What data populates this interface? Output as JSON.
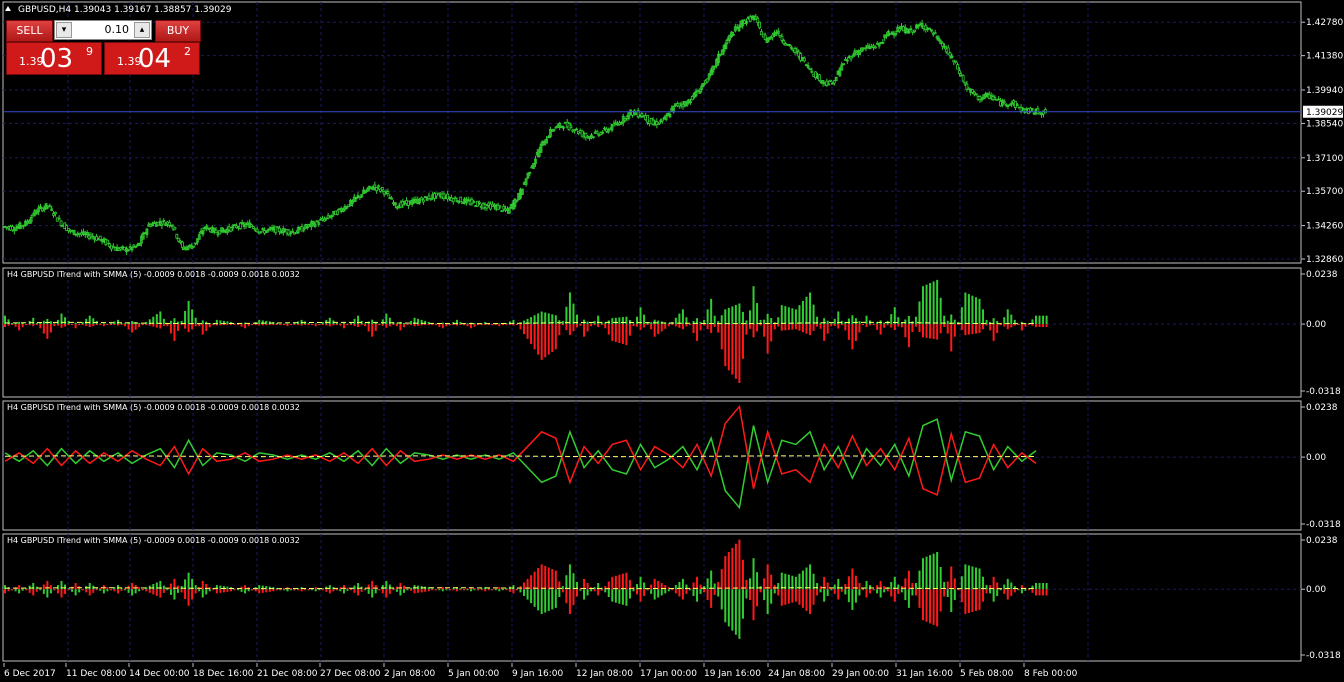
{
  "window": {
    "symbol_header": "GBPUSD,H4  1.39043 1.39167 1.38857 1.39029"
  },
  "trade_panel": {
    "sell_label": "SELL",
    "buy_label": "BUY",
    "lot_value": "0.10",
    "sell_price": {
      "small": "1.39",
      "big": "03",
      "sup": "9"
    },
    "buy_price": {
      "small": "1.39",
      "big": "04",
      "sup": "2"
    }
  },
  "colors": {
    "background": "#000000",
    "grid": "#1a1a66",
    "axis": "#c0c0c0",
    "bull": "#32cd32",
    "bear": "#ff1a1a",
    "signal": "#ffff66",
    "text": "#ffffff",
    "sell_button": "#d01a1a"
  },
  "chart_data": [
    {
      "type": "candlestick",
      "title": "GBPUSD,H4  1.39043 1.39167 1.38857 1.39029",
      "ylim": [
        1.3286,
        1.4346
      ],
      "y_ticks": [
        "1.42780",
        "1.41380",
        "1.39940",
        "1.38540",
        "1.37100",
        "1.35700",
        "1.34260",
        "1.32860"
      ],
      "current_price": "1.39029",
      "close_series": [
        1.3422,
        1.3415,
        1.3435,
        1.349,
        1.351,
        1.3445,
        1.34,
        1.339,
        1.338,
        1.336,
        1.333,
        1.3325,
        1.334,
        1.343,
        1.344,
        1.3435,
        1.333,
        1.3345,
        1.342,
        1.34,
        1.341,
        1.3425,
        1.343,
        1.34,
        1.341,
        1.3405,
        1.34,
        1.342,
        1.344,
        1.346,
        1.349,
        1.352,
        1.356,
        1.359,
        1.357,
        1.351,
        1.352,
        1.353,
        1.3545,
        1.3555,
        1.354,
        1.353,
        1.352,
        1.351,
        1.3505,
        1.3485,
        1.355,
        1.366,
        1.376,
        1.383,
        1.385,
        1.383,
        1.38,
        1.381,
        1.383,
        1.386,
        1.39,
        1.389,
        1.385,
        1.387,
        1.393,
        1.394,
        1.399,
        1.405,
        1.415,
        1.423,
        1.428,
        1.43,
        1.42,
        1.424,
        1.418,
        1.414,
        1.408,
        1.403,
        1.402,
        1.411,
        1.415,
        1.417,
        1.418,
        1.423,
        1.425,
        1.424,
        1.427,
        1.423,
        1.417,
        1.41,
        1.4,
        1.396,
        1.397,
        1.394,
        1.394,
        1.391,
        1.3903
      ]
    },
    {
      "type": "bar",
      "title": "H4 GBPUSD ITrend with SMMA (5) -0.0009 0.0018 -0.0009 0.0018 0.0032",
      "ylim": [
        -0.0318,
        0.0238
      ],
      "y_ticks": [
        "0.0238",
        "0.00",
        "-0.0318"
      ],
      "series": [
        {
          "values": [
            0.004,
            -0.003,
            0.003,
            -0.007,
            0.005,
            -0.002,
            0.004,
            -0.001,
            0.002,
            -0.004,
            0.001,
            0.006,
            -0.008,
            0.011,
            -0.005,
            0.002,
            0.001,
            -0.002,
            0.002,
            0.001,
            -0.001,
            0.002,
            -0.001,
            0.003,
            -0.002,
            0.004,
            -0.006,
            0.005,
            -0.003,
            0.003,
            0.001,
            -0.002,
            0.002,
            -0.002,
            0.001,
            -0.001,
            0.002,
            -0.007,
            -0.017,
            -0.012,
            0.015,
            -0.006,
            0.004,
            -0.008,
            -0.01,
            0.008,
            -0.006,
            -0.001,
            0.007,
            -0.008,
            0.012,
            -0.02,
            -0.028,
            0.018,
            -0.014,
            0.009,
            0.007,
            0.015,
            -0.008,
            0.006,
            -0.012,
            0.004,
            -0.005,
            0.008,
            -0.011,
            0.018,
            0.021,
            -0.013,
            0.015,
            0.012,
            -0.008,
            0.007,
            -0.003,
            0.004
          ]
        },
        {
          "values": [
            0.002,
            -0.002,
            0.003,
            -0.004,
            0.004,
            -0.003,
            0.003,
            -0.002,
            0.002,
            -0.003,
            0.001,
            0.004,
            -0.005,
            0.008,
            -0.004,
            0.002,
            0.001,
            -0.002,
            0.002,
            0.001,
            -0.001,
            0.001,
            -0.001,
            0.002,
            -0.002,
            0.003,
            -0.004,
            0.004,
            -0.003,
            0.002,
            0.001,
            -0.001,
            0.001,
            -0.001,
            0.001,
            -0.001,
            0.002,
            -0.005,
            -0.012,
            -0.009,
            0.012,
            -0.005,
            0.003,
            -0.006,
            -0.008,
            0.006,
            -0.005,
            -0.001,
            0.005,
            -0.006,
            0.009,
            -0.016,
            -0.024,
            0.015,
            -0.012,
            0.008,
            0.006,
            0.012,
            -0.006,
            0.005,
            -0.01,
            0.004,
            -0.004,
            0.006,
            -0.009,
            0.015,
            0.018,
            -0.011,
            0.012,
            0.01,
            -0.006,
            0.005,
            -0.002,
            0.003
          ]
        }
      ]
    },
    {
      "type": "line",
      "title": "H4 GBPUSD ITrend with SMMA (5) -0.0009 0.0018 -0.0009 0.0018 0.0032",
      "ylim": [
        -0.0318,
        0.0238
      ],
      "y_ticks": [
        "0.0238",
        "0.00",
        "-0.0318"
      ]
    },
    {
      "type": "area",
      "title": "H4 GBPUSD ITrend with SMMA (5) -0.0009 0.0018 -0.0009 0.0018 0.0032",
      "ylim": [
        -0.0318,
        0.0238
      ],
      "y_ticks": [
        "0.0238",
        "0.00",
        "-0.0318"
      ]
    }
  ],
  "x_axis": {
    "labels": [
      "6 Dec 2017",
      "11 Dec 08:00",
      "14 Dec 00:00",
      "18 Dec 16:00",
      "21 Dec 08:00",
      "27 Dec 08:00",
      "2 Jan 08:00",
      "5 Jan 00:00",
      "9 Jan 16:00",
      "12 Jan 08:00",
      "17 Jan 00:00",
      "19 Jan 16:00",
      "24 Jan 08:00",
      "29 Jan 00:00",
      "31 Jan 16:00",
      "5 Feb 08:00",
      "8 Feb 00:00"
    ]
  }
}
